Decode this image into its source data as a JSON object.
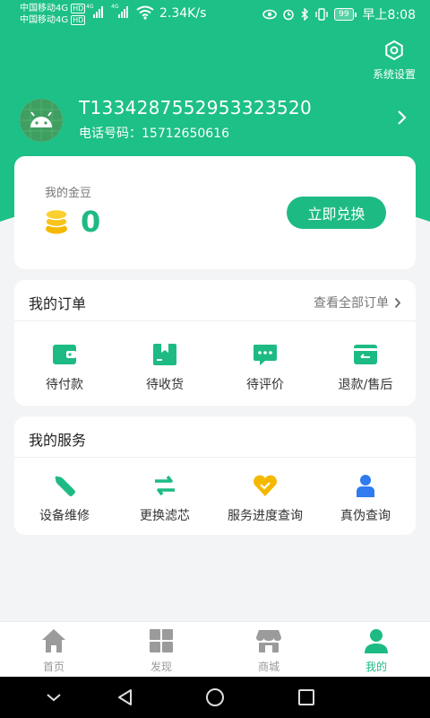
{
  "status_bar": {
    "carrier1": "中国移动4G",
    "carrier2": "中国移动4G",
    "hd": "HD",
    "net_tag": "4G",
    "speed": "2.34K/s",
    "battery": "99",
    "time": "早上8:08"
  },
  "header": {
    "settings_label": "系统设置",
    "user_id": "T1334287552953323520",
    "phone_label": "电话号码：",
    "phone": "15712650616"
  },
  "coins": {
    "title": "我的金豆",
    "count": "0",
    "redeem_label": "立即兑换"
  },
  "orders": {
    "title": "我的订单",
    "see_all": "查看全部订单",
    "items": [
      {
        "label": "待付款",
        "icon": "wallet-icon"
      },
      {
        "label": "待收货",
        "icon": "package-icon"
      },
      {
        "label": "待评价",
        "icon": "comment-icon"
      },
      {
        "label": "退款/售后",
        "icon": "refund-icon"
      }
    ]
  },
  "services": {
    "title": "我的服务",
    "items": [
      {
        "label": "设备维修",
        "icon": "wrench-icon"
      },
      {
        "label": "更换滤芯",
        "icon": "swap-icon"
      },
      {
        "label": "服务进度查询",
        "icon": "heart-progress-icon"
      },
      {
        "label": "真伪查询",
        "icon": "person-icon"
      }
    ]
  },
  "tabbar": {
    "items": [
      {
        "label": "首页",
        "icon": "home-icon"
      },
      {
        "label": "发现",
        "icon": "grid-icon"
      },
      {
        "label": "商城",
        "icon": "store-icon"
      },
      {
        "label": "我的",
        "icon": "user-icon",
        "active": true
      }
    ]
  },
  "colors": {
    "accent": "#1dc087",
    "coin": "#f5b800",
    "service_blue": "#2f7bef",
    "inactive": "#9b9b9b"
  }
}
